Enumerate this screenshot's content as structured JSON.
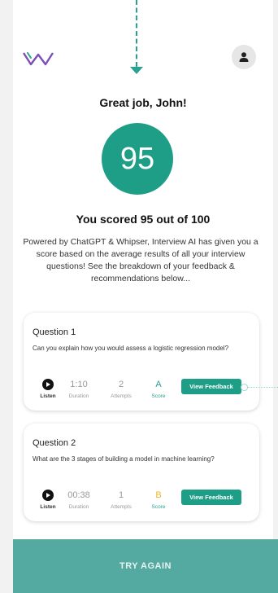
{
  "header": {
    "logo_icon": "w-logo-icon",
    "avatar_icon": "user-icon"
  },
  "result": {
    "greeting": "Great job, John!",
    "score": "95",
    "score_line": "You scored 95 out of 100",
    "summary": "Powered by ChatGPT & Whipser, Interview AI has given you a score based on the average results of all your interview questions! See the breakdown of your feedback & recommendations below..."
  },
  "questions": [
    {
      "title": "Question 1",
      "text": "Can you explain how you would assess a logistic regression model?",
      "listen_label": "Listen",
      "duration": "1:10",
      "duration_label": "Duration",
      "attempts": "2",
      "attempts_label": "Attempts",
      "grade": "A",
      "grade_label": "Score",
      "feedback_label": "View Feedback"
    },
    {
      "title": "Question 2",
      "text": "What are the 3 stages of building a model in machine learning?",
      "listen_label": "Listen",
      "duration": "00:38",
      "duration_label": "Duration",
      "attempts": "1",
      "attempts_label": "Attempts",
      "grade": "B",
      "grade_label": "Score",
      "feedback_label": "View Feedback"
    }
  ],
  "footer": {
    "try_again_label": "TRY AGAIN"
  },
  "colors": {
    "accent": "#1e9e86",
    "grade_a": "#2aa191",
    "grade_b": "#e8b923",
    "footer_bg": "#54a9a0"
  }
}
